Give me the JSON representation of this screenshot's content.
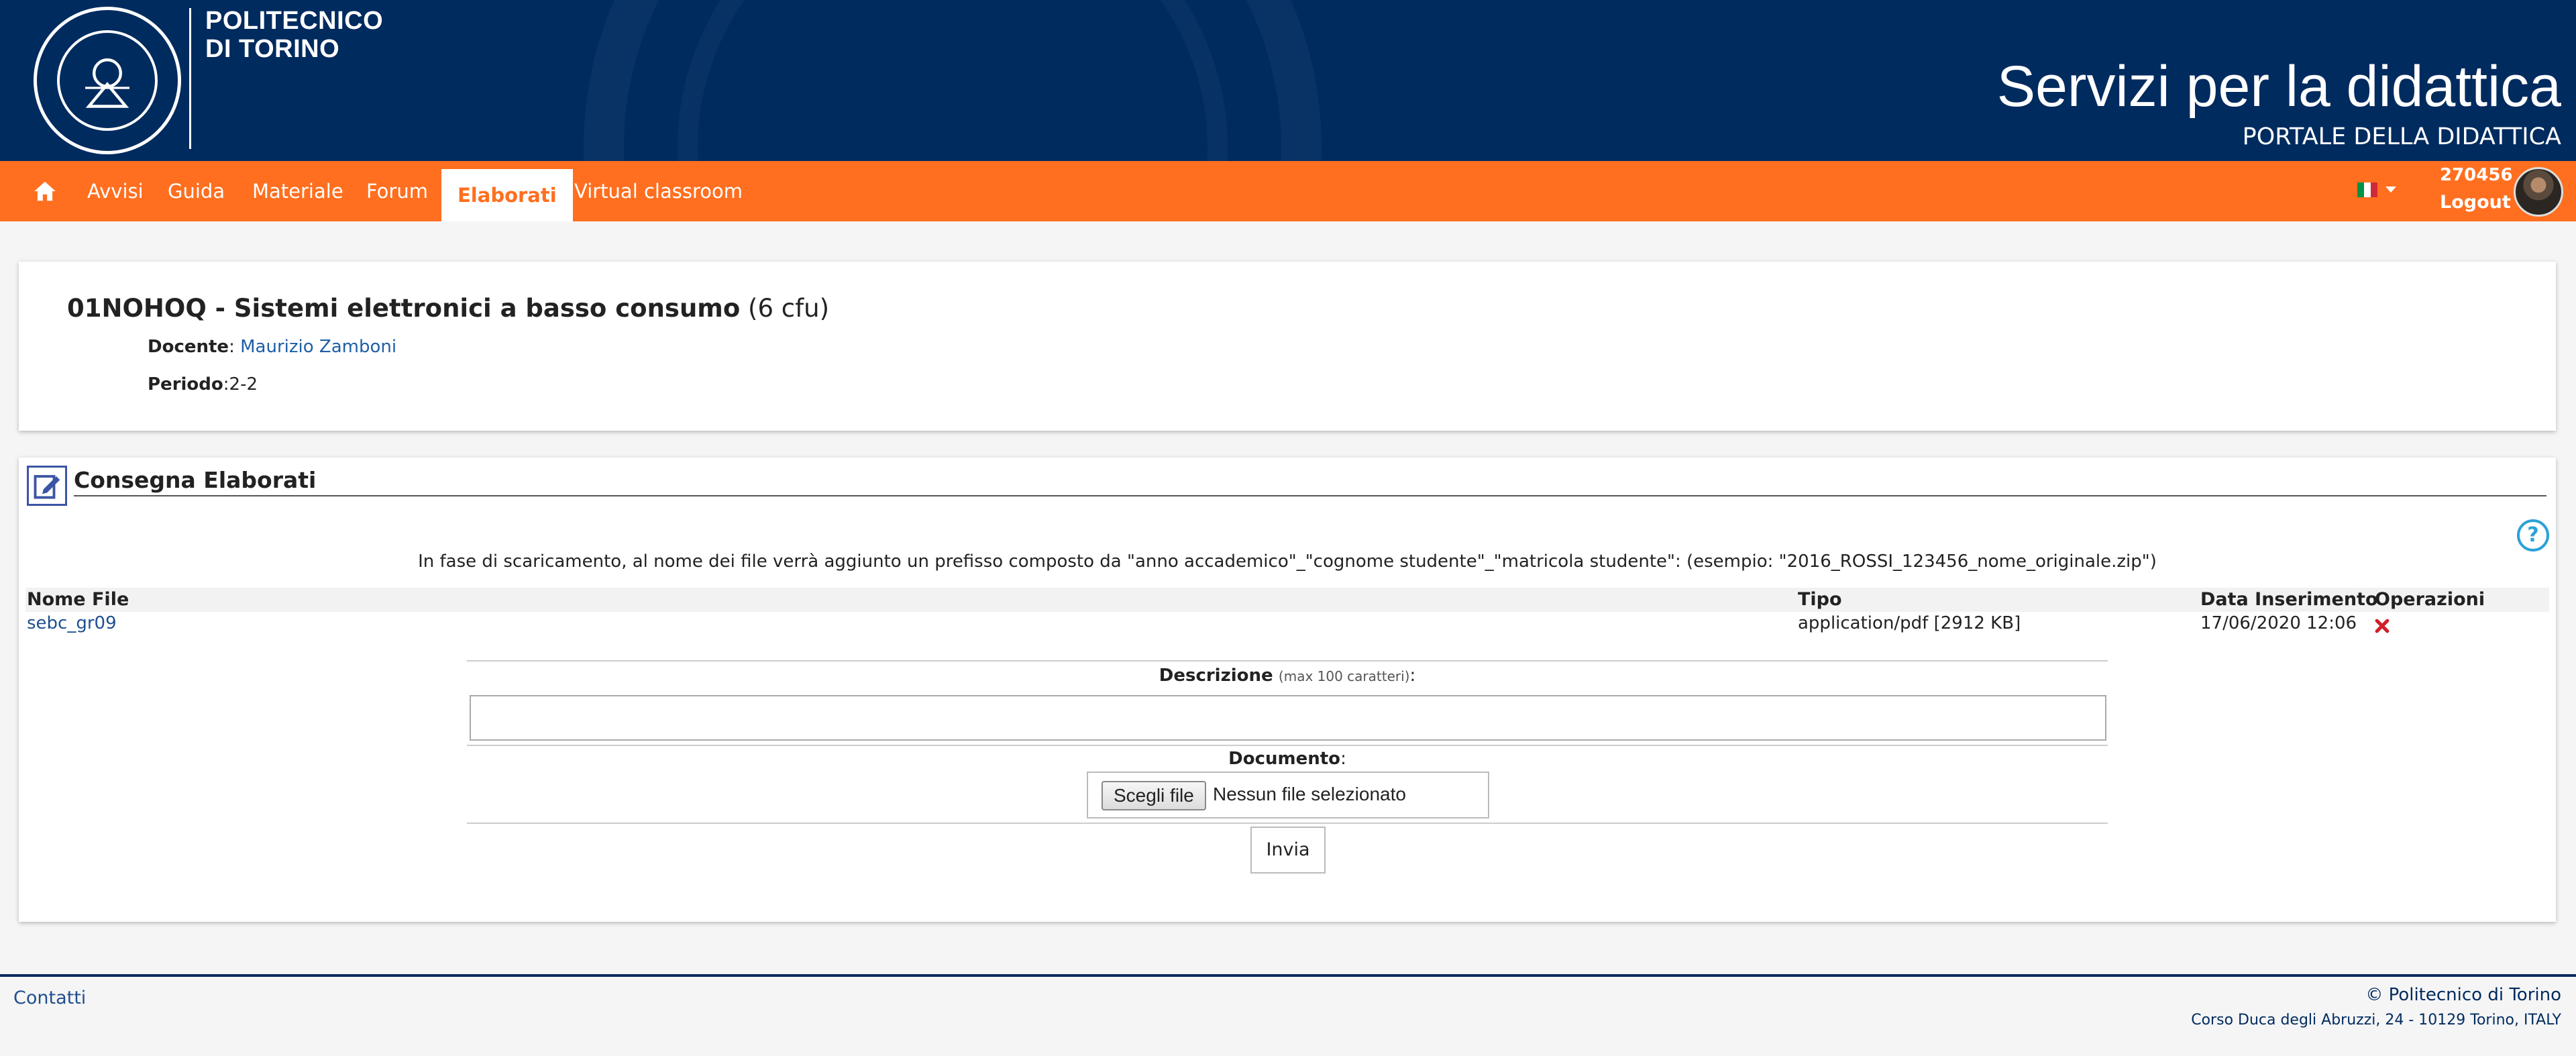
{
  "header": {
    "logo_line1": "POLITECNICO",
    "logo_line2": "DI TORINO",
    "title": "Servizi per la didattica",
    "subtitle": "PORTALE DELLA DIDATTICA"
  },
  "nav": {
    "items": [
      {
        "label": "Avvisi"
      },
      {
        "label": "Guida"
      },
      {
        "label": "Materiale"
      },
      {
        "label": "Forum"
      },
      {
        "label": "Elaborati"
      },
      {
        "label": "Virtual classroom"
      }
    ],
    "active": "Elaborati",
    "user_id": "270456",
    "logout": "Logout",
    "language_flag": "flag-italy-icon",
    "colors": {
      "primary": "#002b5f",
      "accent": "#ff6f1f"
    }
  },
  "course": {
    "code_name": "01NOHOQ - Sistemi elettronici a basso consumo",
    "cfu": "(6 cfu)",
    "docente_label": "Docente",
    "docente": "Maurizio Zamboni",
    "periodo_label": "Periodo",
    "periodo": "2-2"
  },
  "consegna": {
    "title": "Consegna Elaborati",
    "info": "In fase di scaricamento, al nome dei file verrà aggiunto un prefisso composto da \"anno accademico\"_\"cognome studente\"_\"matricola studente\": (esempio: \"2016_ROSSI_123456_nome_originale.zip\")",
    "columns": [
      "Nome File",
      "Tipo",
      "Data Inserimento",
      "Operazioni"
    ],
    "rows": [
      {
        "name": "sebc_gr09",
        "type": "application/pdf [2912 KB]",
        "date": "17/06/2020 12:06",
        "op": "delete-icon"
      }
    ],
    "descrizione_label": "Descrizione",
    "descrizione_hint": "(max 100 caratteri)",
    "descrizione_value": "",
    "documento_label": "Documento",
    "file_button": "Scegli file",
    "file_status": "Nessun file selezionato",
    "submit": "Invia"
  },
  "footer": {
    "contatti": "Contatti",
    "copyright": "© Politecnico di Torino",
    "address": "Corso Duca degli Abruzzi, 24 - 10129 Torino, ITALY"
  }
}
